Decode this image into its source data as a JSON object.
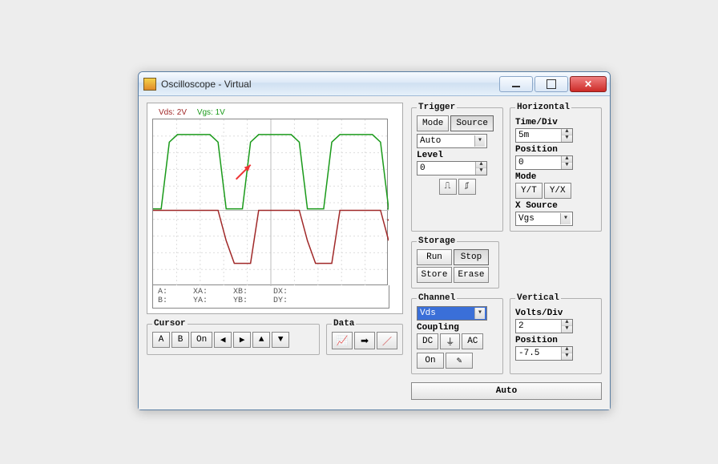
{
  "window": {
    "title": "Oscilloscope - Virtual"
  },
  "traces": {
    "vds_label": "Vds: 2V",
    "vgs_label": "Vgs: 1V"
  },
  "readouts": {
    "rowA": {
      "a": "A:",
      "xa": "XA:",
      "xb": "XB:",
      "dx": "DX:"
    },
    "rowB": {
      "a": "B:",
      "xa": "YA:",
      "xb": "YB:",
      "dx": "DY:"
    }
  },
  "cursor": {
    "legend": "Cursor",
    "a": "A",
    "b": "B",
    "on": "On"
  },
  "data": {
    "legend": "Data"
  },
  "trigger": {
    "legend": "Trigger",
    "mode_btn": "Mode",
    "source_btn": "Source",
    "mode_value": "Auto",
    "level_label": "Level",
    "level_value": "0"
  },
  "storage": {
    "legend": "Storage",
    "run": "Run",
    "stop": "Stop",
    "store": "Store",
    "erase": "Erase"
  },
  "channel": {
    "legend": "Channel",
    "value": "Vds",
    "coupling_label": "Coupling",
    "dc": "DC",
    "gnd": "⏚",
    "ac": "AC",
    "on": "On"
  },
  "horizontal": {
    "legend": "Horizontal",
    "timediv_label": "Time/Div",
    "timediv_value": "5m",
    "position_label": "Position",
    "position_value": "0",
    "mode_label": "Mode",
    "yt": "Y/T",
    "yx": "Y/X",
    "xsource_label": "X Source",
    "xsource_value": "Vgs"
  },
  "vertical": {
    "legend": "Vertical",
    "voltsdiv_label": "Volts/Div",
    "voltsdiv_value": "2",
    "position_label": "Position",
    "position_value": "-7.5"
  },
  "auto_btn": "Auto",
  "chart_data": {
    "type": "line",
    "title": "",
    "xlabel": "",
    "ylabel": "",
    "x": [
      0,
      1,
      2,
      3,
      4,
      5,
      6,
      7,
      8,
      9,
      10,
      11,
      12,
      13,
      14,
      15,
      16,
      17,
      18,
      19,
      20,
      21,
      22,
      23,
      24,
      25,
      26,
      27,
      28,
      29
    ],
    "series": [
      {
        "name": "Vgs",
        "color": "#1a9a1a",
        "values": [
          0.1,
          0.1,
          4.5,
          5.0,
          5.0,
          5.0,
          5.0,
          5.0,
          4.5,
          0.1,
          0.1,
          0.1,
          4.5,
          5.0,
          5.0,
          5.0,
          5.0,
          5.0,
          4.5,
          0.1,
          0.1,
          0.1,
          4.5,
          5.0,
          5.0,
          5.0,
          5.0,
          5.0,
          4.5,
          0.1
        ]
      },
      {
        "name": "Vds",
        "color": "#a02828",
        "values": [
          0.0,
          0.0,
          0.0,
          0.0,
          0.0,
          0.0,
          0.0,
          0.0,
          0.0,
          -2.0,
          -3.5,
          -3.5,
          -3.5,
          0.0,
          0.0,
          0.0,
          0.0,
          0.0,
          0.0,
          -2.0,
          -3.5,
          -3.5,
          -3.5,
          0.0,
          0.0,
          0.0,
          0.0,
          0.0,
          0.0,
          -2.0
        ]
      }
    ],
    "xlim": [
      0,
      29
    ],
    "ylim": [
      -5,
      6
    ],
    "grid": true,
    "annotations": [
      {
        "type": "arrow",
        "color": "#e33",
        "x": 12,
        "y": 3.0,
        "note": "red arrow"
      }
    ]
  }
}
